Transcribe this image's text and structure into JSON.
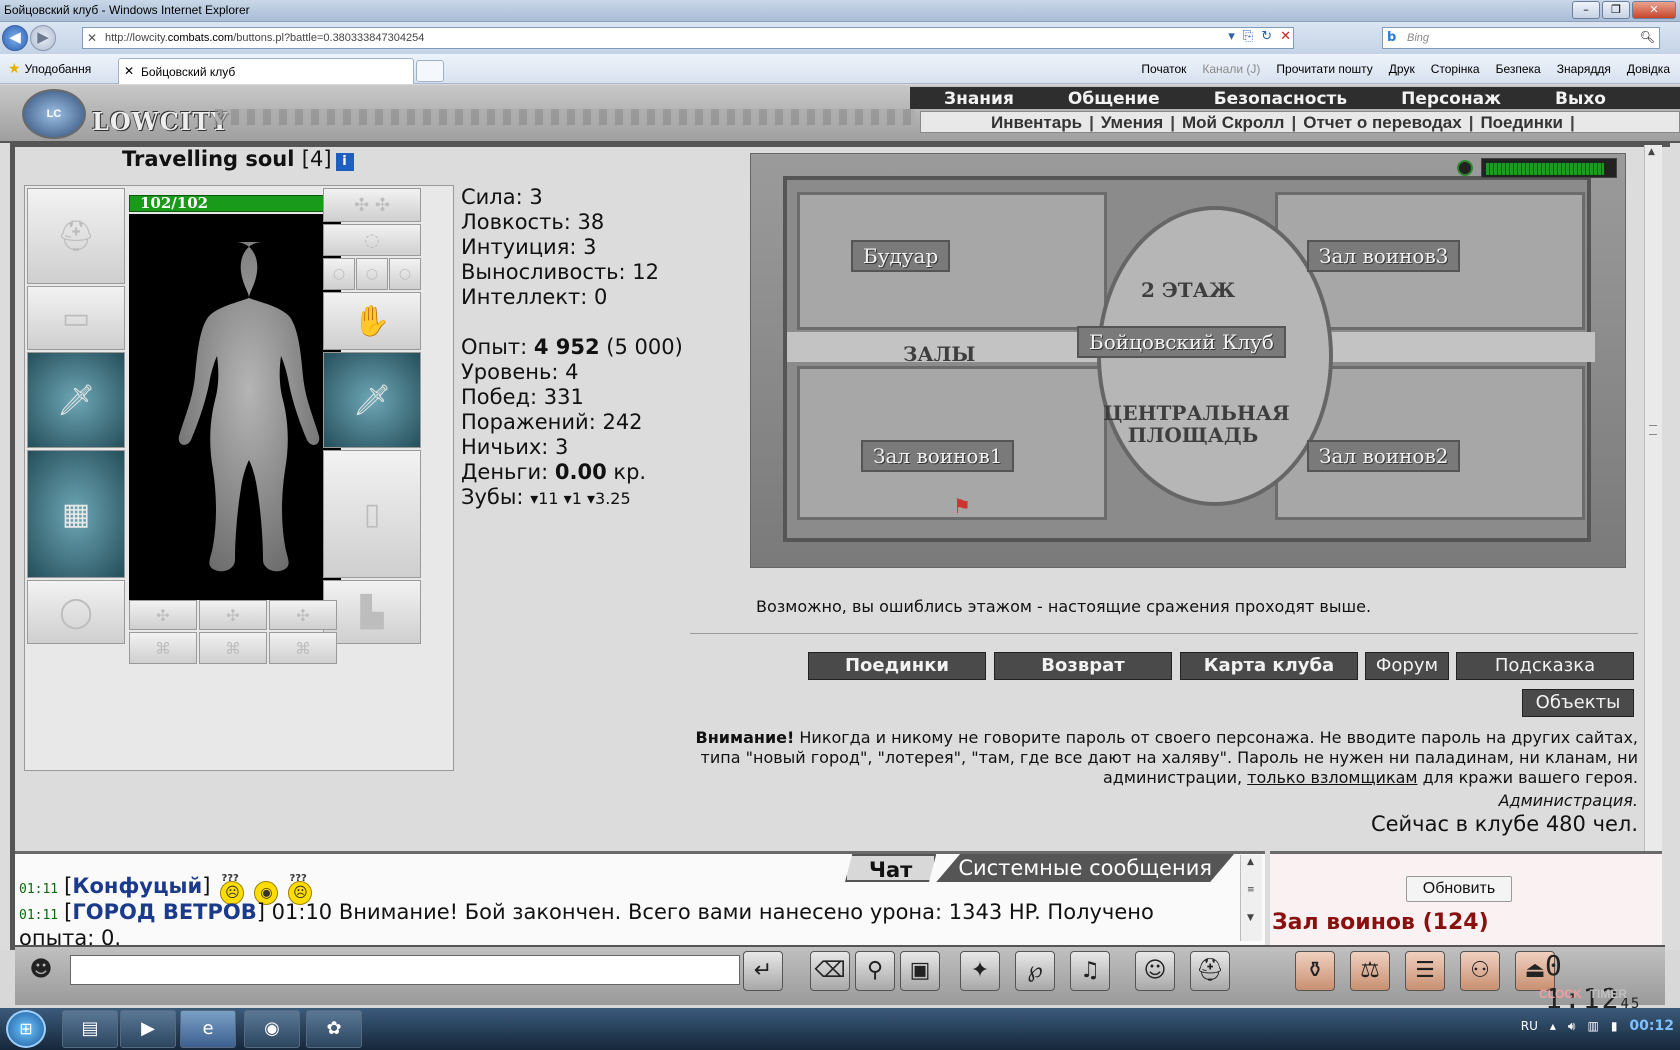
{
  "browser": {
    "title": "Бойцовский клуб - Windows Internet Explorer",
    "url_prefix": "http://lowcity.",
    "url_domain": "combats.com",
    "url_path": "/buttons.pl?battle=0.380333847304254",
    "search_placeholder": "Bing",
    "favorites_label": "Уподобання",
    "tab_title": "Бойцовский клуб",
    "commands": [
      "Початок",
      "Канали (J)",
      "Прочитати пошту",
      "Друк",
      "Сторінка",
      "Безпека",
      "Знаряддя",
      "Довідка"
    ]
  },
  "game": {
    "logo_text": "LOWCITY",
    "top_nav": [
      "Знания",
      "Общение",
      "Безопасность",
      "Персонаж",
      "Выхо"
    ],
    "sub_nav": [
      "Инвентарь",
      "Умения",
      "Мой Скролл",
      "Отчет о переводах",
      "Поединки"
    ],
    "character": {
      "name": "Travelling soul",
      "level": "[4]",
      "hp": "102/102",
      "hp_fraction": 1.0
    },
    "stats": {
      "strength": "Сила: 3",
      "agility": "Ловкость: 38",
      "intuition": "Интуиция: 3",
      "endurance": "Выносливость: 12",
      "intellect": "Интеллект: 0",
      "exp_label": "Опыт:",
      "exp_value": "4 952",
      "exp_next": "(5 000)",
      "level": "Уровень: 4",
      "wins": "Побед: 331",
      "losses": "Поражений: 242",
      "draws": "Ничьих: 3",
      "money_label": "Деньги:",
      "money_value": "0.00",
      "money_unit": "кр.",
      "teeth_label": "Зубы:",
      "teeth_1": "11",
      "teeth_2": "1",
      "teeth_3": "3.25"
    },
    "map": {
      "labels": {
        "boudoir": "Будуар",
        "hall3": "Зал воинов3",
        "floor2": "2 ЭТАЖ",
        "halls": "ЗАЛЫ",
        "club": "Бойцовский Клуб",
        "central": "ЦЕНТРАЛЬНАЯ ПЛОЩАДЬ",
        "hall1": "Зал воинов1",
        "hall2": "Зал воинов2"
      },
      "message": "Возможно, вы ошиблись этажом - настоящие сражения проходят выше."
    },
    "buttons": {
      "duels": "Поединки",
      "return": "Возврат",
      "club_map": "Карта клуба",
      "forum": "Форум",
      "hint": "Подсказка",
      "objects": "Объекты"
    },
    "warning": {
      "bold": "Внимание!",
      "text1": " Никогда и никому не говорите пароль от своего персонажа. Не вводите пароль на других сайтах, типа \"новый город\", \"лотерея\", \"там, где все дают на халяву\". Пароль не нужен ни паладинам, ни кланам, ни администрации, ",
      "link": "только взломщикам",
      "text2": " для кражи вашего героя.",
      "admin": "Администрация.",
      "online": "Сейчас в клубе 480 чел."
    },
    "chat": {
      "tabs": [
        "Чат",
        "Системные сообщения"
      ],
      "lines": [
        {
          "time": "01:11",
          "nick": "Конфуцый",
          "text": ""
        },
        {
          "time": "01:11",
          "nick": "ГОРОД ВЕТРОВ",
          "text": " 01:10 Внимание! Бой закончен. Всего вами нанесено урона: 1343 HP. Получено"
        },
        {
          "text": "опыта: 0."
        }
      ],
      "smile_marks": "???"
    },
    "side": {
      "refresh": "Обновить",
      "hall": "Зал воинов (124)"
    },
    "clock": {
      "time": "0 1:12",
      "seconds": "45",
      "label_a": "CLOCK",
      "label_b": "TIMER"
    }
  },
  "taskbar": {
    "lang": "RU",
    "time": "00:12"
  }
}
